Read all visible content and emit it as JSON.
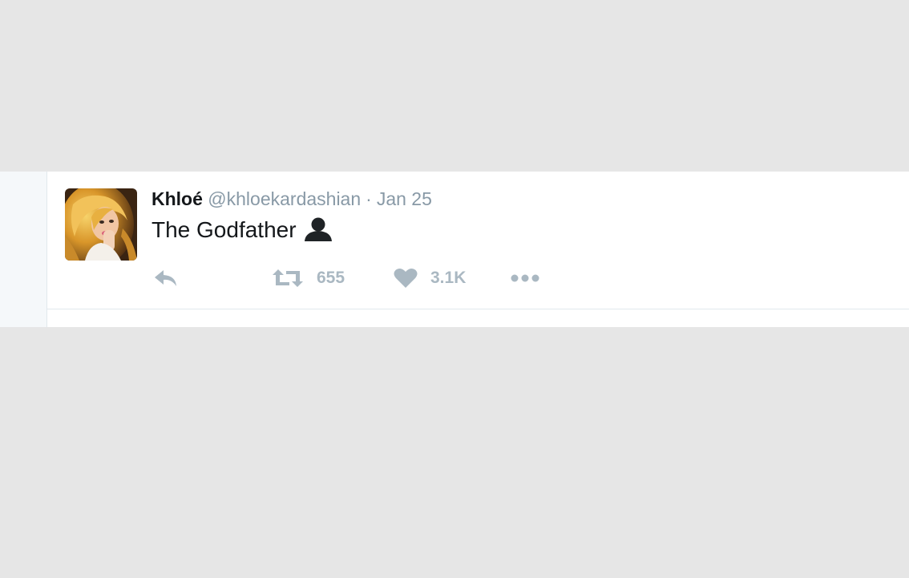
{
  "tweet": {
    "author_name": "Khloé",
    "handle": "@khloekardashian",
    "separator": "·",
    "timestamp": "Jan 25",
    "text": "The Godfather",
    "emoji_icon": "bust-in-silhouette-icon",
    "retweet_count": "655",
    "like_count": "3.1K"
  },
  "icons": {
    "reply": "reply-arrow-icon",
    "retweet": "retweet-icon",
    "like": "heart-icon",
    "more": "more-dots-icon"
  },
  "colors": {
    "background": "#e6e6e6",
    "card": "#ffffff",
    "muted": "#8899a6",
    "action_icon": "#aab8c2",
    "text": "#14171a"
  }
}
